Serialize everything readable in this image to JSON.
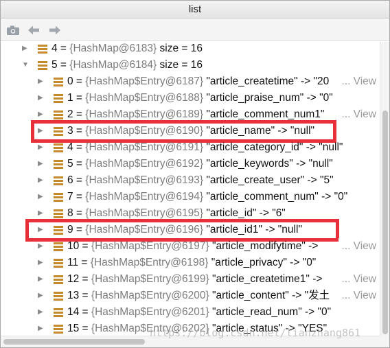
{
  "window": {
    "title": "list"
  },
  "toolbar": {
    "buttons": [
      "camera-icon",
      "back-arrow-icon",
      "forward-arrow-icon"
    ]
  },
  "rows": [
    {
      "level": 0,
      "expanded": false,
      "index": "4",
      "ref": "{HashMap@6183}",
      "entry": "size = 16",
      "view": ""
    },
    {
      "level": 0,
      "expanded": true,
      "index": "5",
      "ref": "{HashMap@6184}",
      "entry": "size = 16",
      "view": ""
    },
    {
      "level": 1,
      "expanded": false,
      "index": "0",
      "ref": "{HashMap$Entry@6187}",
      "entry": "\"article_createtime\" -> \"20",
      "view": "... View"
    },
    {
      "level": 1,
      "expanded": false,
      "index": "1",
      "ref": "{HashMap$Entry@6188}",
      "entry": "\"article_praise_num\" -> \"0\"",
      "view": ""
    },
    {
      "level": 1,
      "expanded": false,
      "index": "2",
      "ref": "{HashMap$Entry@6189}",
      "entry": "\"article_comment_num1\"",
      "view": "... View"
    },
    {
      "level": 1,
      "expanded": false,
      "index": "3",
      "ref": "{HashMap$Entry@6190}",
      "entry": "\"article_name\" -> \"null\"",
      "view": ""
    },
    {
      "level": 1,
      "expanded": false,
      "index": "4",
      "ref": "{HashMap$Entry@6191}",
      "entry": "\"article_category_id\" -> \"null\"",
      "view": ""
    },
    {
      "level": 1,
      "expanded": false,
      "index": "5",
      "ref": "{HashMap$Entry@6192}",
      "entry": "\"article_keywords\" -> \"null\"",
      "view": ""
    },
    {
      "level": 1,
      "expanded": false,
      "index": "6",
      "ref": "{HashMap$Entry@6193}",
      "entry": "\"article_create_user\" -> \"5\"",
      "view": ""
    },
    {
      "level": 1,
      "expanded": false,
      "index": "7",
      "ref": "{HashMap$Entry@6194}",
      "entry": "\"article_comment_num\" -> \"0\"",
      "view": ""
    },
    {
      "level": 1,
      "expanded": false,
      "index": "8",
      "ref": "{HashMap$Entry@6195}",
      "entry": "\"article_id\" -> \"6\"",
      "view": ""
    },
    {
      "level": 1,
      "expanded": false,
      "index": "9",
      "ref": "{HashMap$Entry@6196}",
      "entry": "\"article_id1\" -> \"null\"",
      "view": ""
    },
    {
      "level": 1,
      "expanded": false,
      "index": "10",
      "ref": "{HashMap$Entry@6197}",
      "entry": "\"article_modifytime\" ->",
      "view": "... View"
    },
    {
      "level": 1,
      "expanded": false,
      "index": "11",
      "ref": "{HashMap$Entry@6198}",
      "entry": "\"article_privacy\" -> \"0\"",
      "view": ""
    },
    {
      "level": 1,
      "expanded": false,
      "index": "12",
      "ref": "{HashMap$Entry@6199}",
      "entry": "\"article_createtime1\" ->",
      "view": "... View"
    },
    {
      "level": 1,
      "expanded": false,
      "index": "13",
      "ref": "{HashMap$Entry@6200}",
      "entry": "\"article_content\" -> \"发土",
      "view": "... View"
    },
    {
      "level": 1,
      "expanded": false,
      "index": "14",
      "ref": "{HashMap$Entry@6201}",
      "entry": "\"article_read_num\" -> \"0\"",
      "view": ""
    },
    {
      "level": 1,
      "expanded": false,
      "index": "15",
      "ref": "{HashMap$Entry@6202}",
      "entry": "\"article_status\" -> \"YES\"",
      "view": ""
    }
  ],
  "highlighted_indices": [
    "3",
    "9"
  ],
  "watermark": "https://blog.csdn.net/lianzhang861",
  "colors": {
    "highlight": "#e8303a",
    "icon": "#c48a2a"
  }
}
